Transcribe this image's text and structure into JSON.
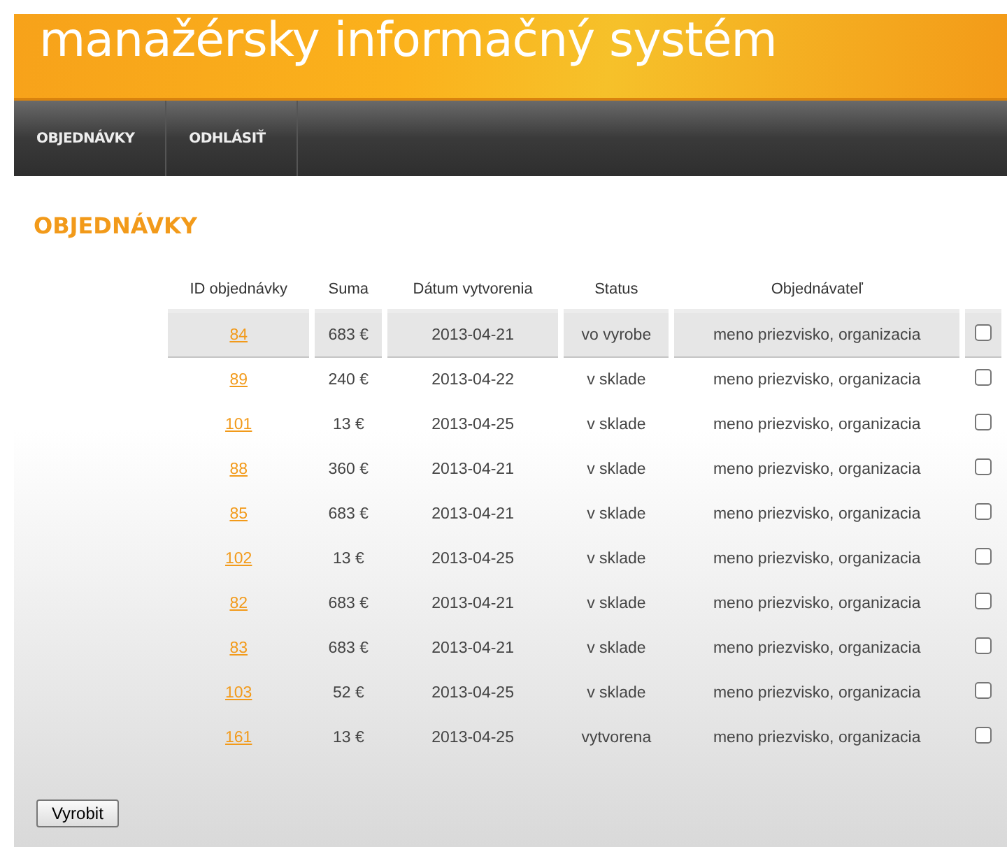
{
  "header": {
    "title": "manažérsky informačný systém"
  },
  "nav": [
    {
      "label": "OBJEDNÁVKY"
    },
    {
      "label": "ODHLÁSIŤ"
    }
  ],
  "page_title": "OBJEDNÁVKY",
  "table": {
    "columns": [
      "ID objednávky",
      "Suma",
      "Dátum vytvorenia",
      "Status",
      "Objednávateľ"
    ],
    "rows": [
      {
        "id": "84",
        "sum": "683 €",
        "date": "2013-04-21",
        "status": "vo vyrobe",
        "customer": "meno priezvisko, organizacia",
        "checked": false,
        "highlighted": true
      },
      {
        "id": "89",
        "sum": "240 €",
        "date": "2013-04-22",
        "status": "v sklade",
        "customer": "meno priezvisko, organizacia",
        "checked": false,
        "highlighted": false
      },
      {
        "id": "101",
        "sum": "13 €",
        "date": "2013-04-25",
        "status": "v sklade",
        "customer": "meno priezvisko, organizacia",
        "checked": false,
        "highlighted": false
      },
      {
        "id": "88",
        "sum": "360 €",
        "date": "2013-04-21",
        "status": "v sklade",
        "customer": "meno priezvisko, organizacia",
        "checked": false,
        "highlighted": false
      },
      {
        "id": "85",
        "sum": "683 €",
        "date": "2013-04-21",
        "status": "v sklade",
        "customer": "meno priezvisko, organizacia",
        "checked": false,
        "highlighted": false
      },
      {
        "id": "102",
        "sum": "13 €",
        "date": "2013-04-25",
        "status": "v sklade",
        "customer": "meno priezvisko, organizacia",
        "checked": false,
        "highlighted": false
      },
      {
        "id": "82",
        "sum": "683 €",
        "date": "2013-04-21",
        "status": "v sklade",
        "customer": "meno priezvisko, organizacia",
        "checked": false,
        "highlighted": false
      },
      {
        "id": "83",
        "sum": "683 €",
        "date": "2013-04-21",
        "status": "v sklade",
        "customer": "meno priezvisko, organizacia",
        "checked": false,
        "highlighted": false
      },
      {
        "id": "103",
        "sum": "52 €",
        "date": "2013-04-25",
        "status": "v sklade",
        "customer": "meno priezvisko, organizacia",
        "checked": false,
        "highlighted": false
      },
      {
        "id": "161",
        "sum": "13 €",
        "date": "2013-04-25",
        "status": "vytvorena",
        "customer": "meno priezvisko, organizacia",
        "checked": false,
        "highlighted": false
      }
    ]
  },
  "button": "Vyrobit"
}
